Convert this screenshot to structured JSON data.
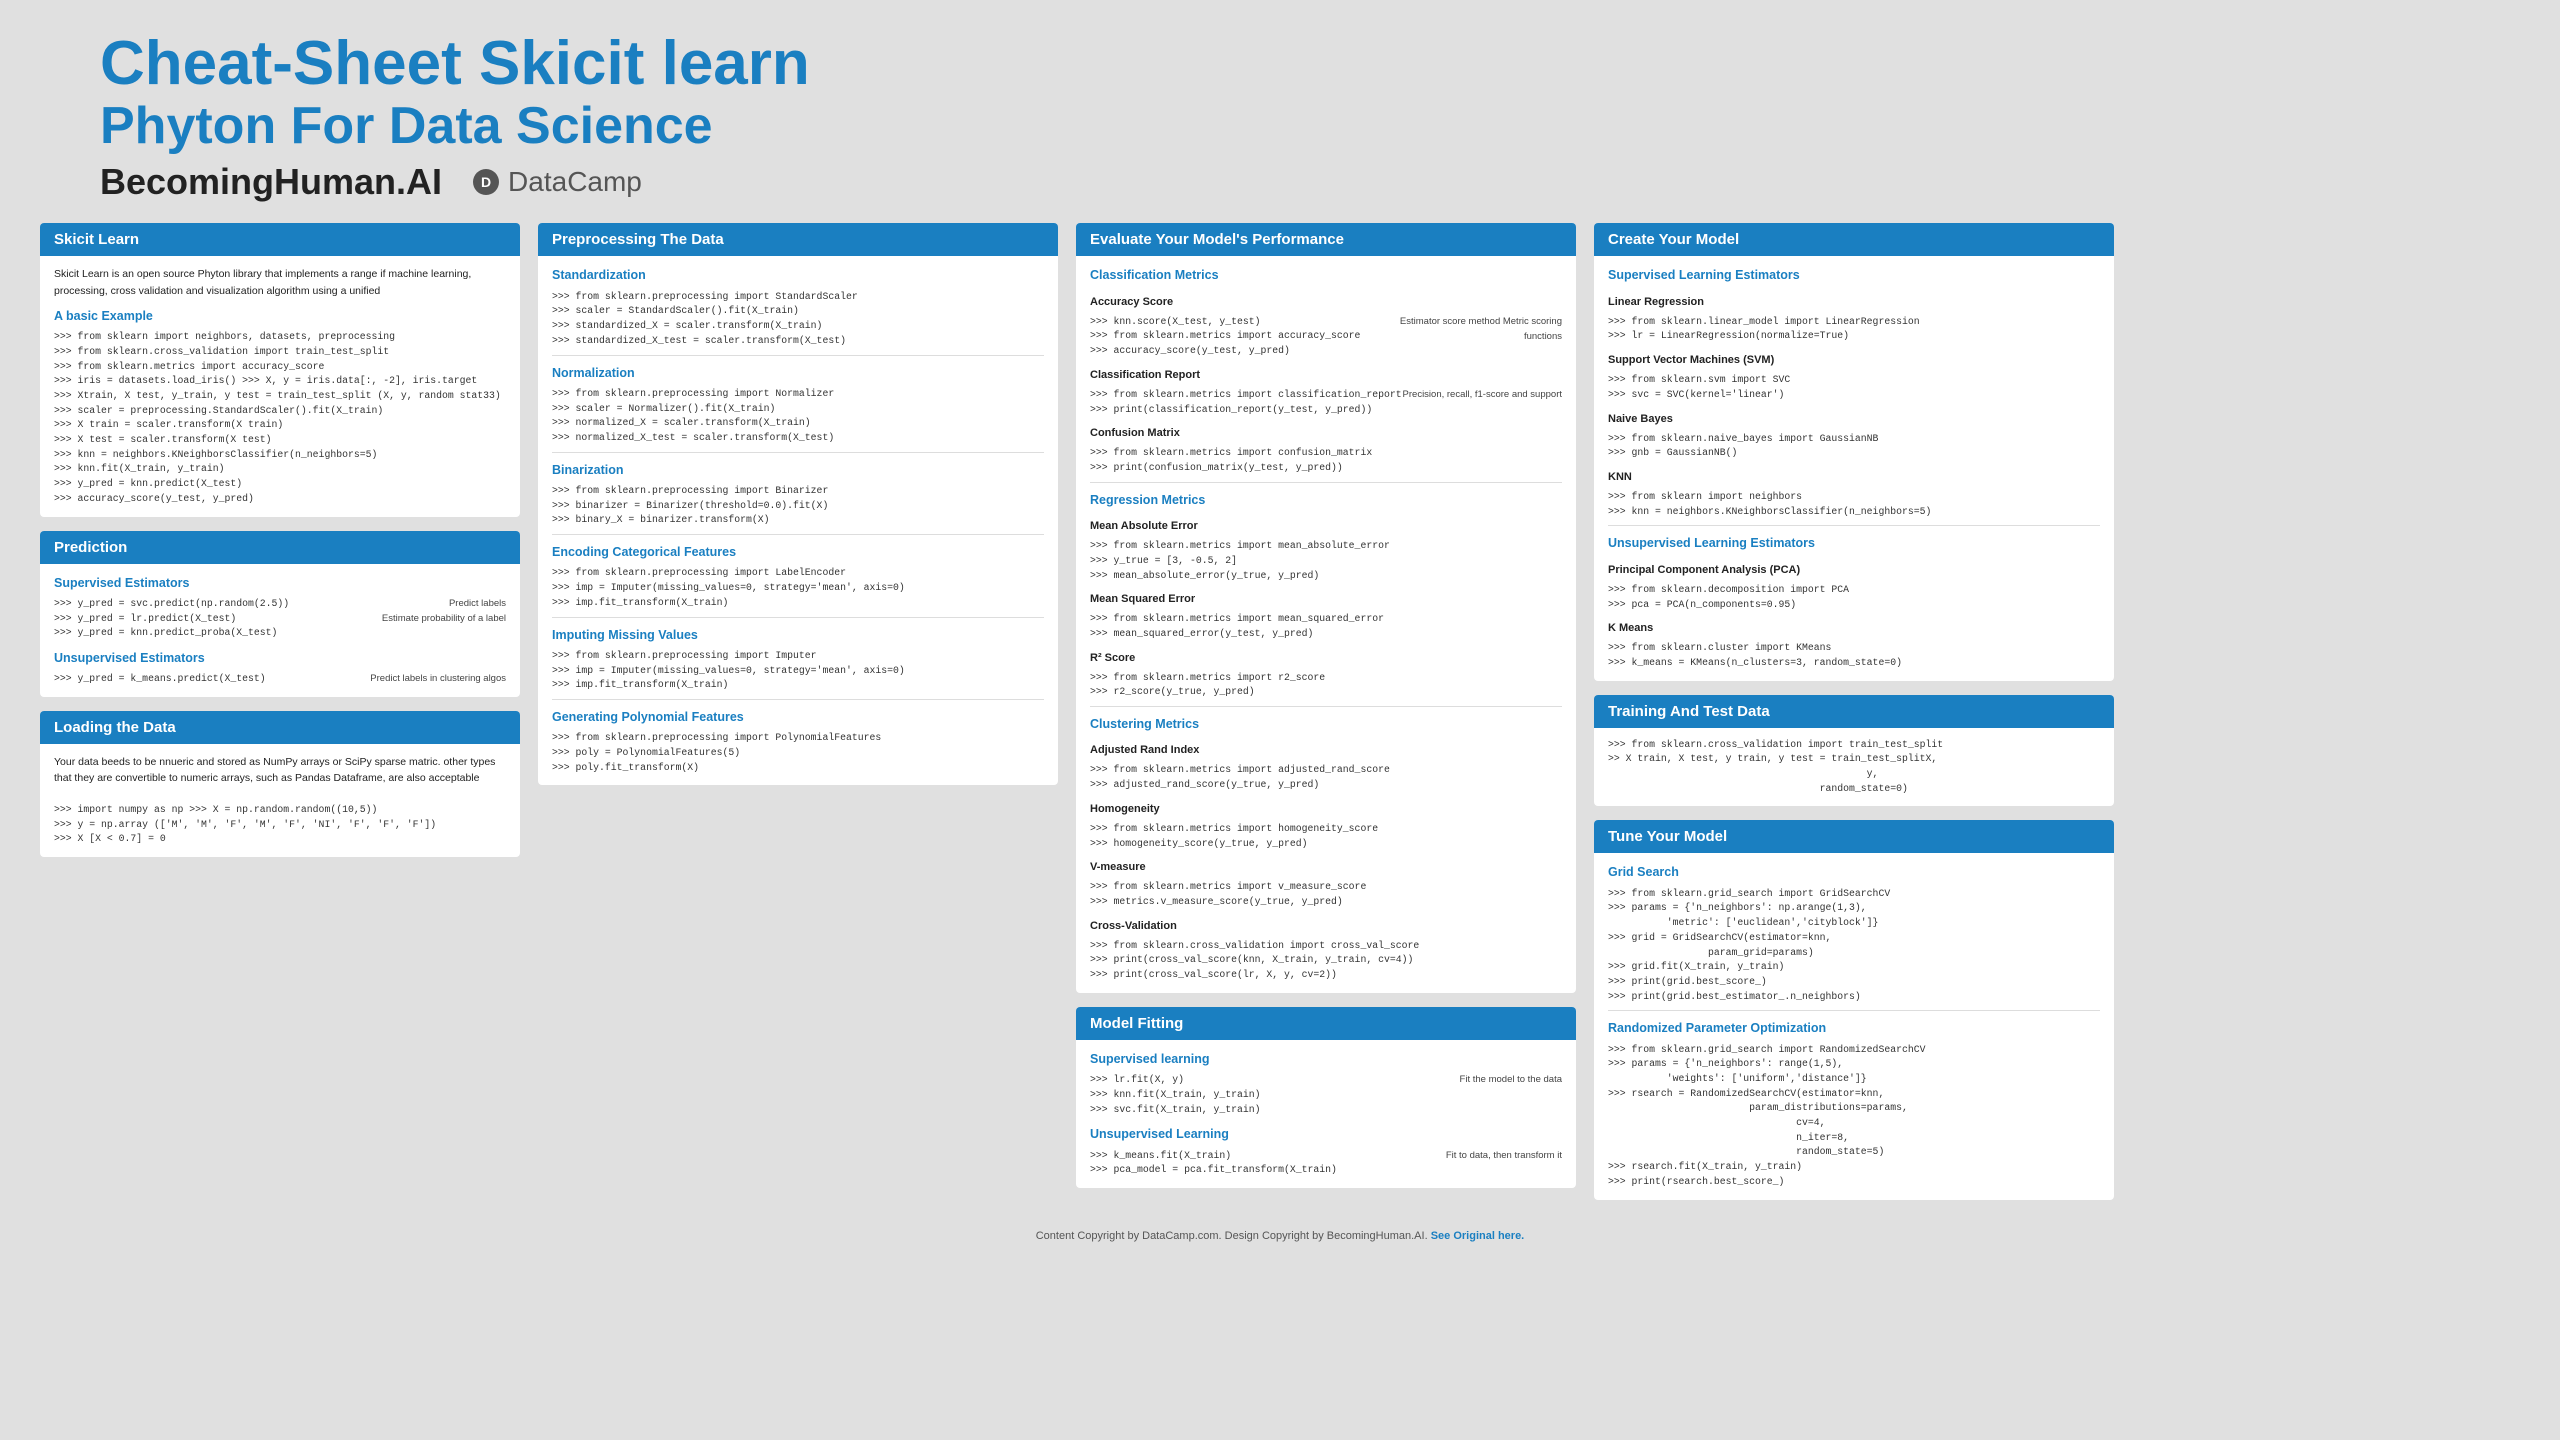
{
  "header": {
    "line1": "Cheat-Sheet  Skicit learn",
    "line2": "Phyton For Data Science",
    "brand": "BecomingHuman.AI",
    "datacamp_label": "DataCamp"
  },
  "footer": {
    "text": "Content Copyright by DataCamp.com. Design Copyright by BecomingHuman.AI.",
    "link_text": "See Original here."
  },
  "col1": {
    "skicit_learn": {
      "title": "Skicit Learn",
      "intro": "Skicit Learn is an open source Phyton library that implements a range if machine learning, processing, cross validation and visualization algorithm using a unified",
      "basic_example_title": "A basic Example",
      "basic_example_code": ">>> from sklearn import neighbors, datasets, preprocessing\n>>> from sklearn.cross_validation import train_test_split\n>>> from sklearn.metrics import accuracy_score\n>>> iris = datasets.load_iris() >>> X, y = iris.data[:, -2], iris.target\n>>> Xtrain, X test, y_train, y test = train_test_split (X, y, random stat33)\n>>> scaler = preprocessing.StandardScaler().fit(X_train)\n>>> X train = scaler.transform(X train)\n>>> X test = scaler.transform(X test)\n>>> knn = neighbors.KNeighborsClassifier(n_neighbors=5)\n>>> knn.fit(X_train, y_train)\n>>> y_pred = knn.predict(X_test)\n>>> accuracy_score(y_test, y_pred)"
    },
    "prediction": {
      "title": "Prediction",
      "supervised_title": "Supervised Estimators",
      "supervised_code": ">>> y_pred = svc.predict(np.random(2.5))\n>>> y_pred = lr.predict(X_test)\n>>> y_pred = knn.predict_proba(X_test)",
      "supervised_right1": "Predict labels",
      "supervised_right2": "Estimate probability of a label",
      "unsupervised_title": "Unsupervised Estimators",
      "unsupervised_code": ">>> y_pred = k_means.predict(X_test)",
      "unsupervised_right": "Predict labels in clustering algos"
    },
    "loading": {
      "title": "Loading the Data",
      "description": "Your data beeds to be nnueric and stored as NumPy arrays or SciPy sparse matric. other types that they are convertible to numeric arrays, such as Pandas Dataframe, are also acceptable",
      "code": ">>> import numpy as np >>> X = np.random.random((10,5))\n>>> y = np.array (['M', 'M', 'F', 'M', 'F', 'NI', 'F', 'F', 'F'])\n>>> X [X < 0.7] = 0"
    }
  },
  "col2": {
    "preprocessing": {
      "title": "Preprocessing The Data",
      "standardization_title": "Standardization",
      "standardization_code": ">>> from sklearn.preprocessing import StandardScaler\n>>> scaler = StandardScaler().fit(X_train)\n>>> standardized_X = scaler.transform(X_train)\n>>> standardized_X_test = scaler.transform(X_test)",
      "normalization_title": "Normalization",
      "normalization_code": ">>> from sklearn.preprocessing import Normalizer\n>>> scaler = Normalizer().fit(X_train)\n>>> normalized_X = scaler.transform(X_train)\n>>> normalized_X_test = scaler.transform(X_test)",
      "binarization_title": "Binarization",
      "binarization_code": ">>> from sklearn.preprocessing import Binarizer\n>>> binarizer = Binarizer(threshold=0.0).fit(X)\n>>> binary_X = binarizer.transform(X)",
      "encoding_title": "Encoding Categorical Features",
      "encoding_code": ">>> from sklearn.preprocessing import LabelEncoder\n>>> imp = Imputer(missing_values=0, strategy='mean', axis=0)\n>>> imp.fit_transform(X_train)",
      "imputing_title": "Imputing Missing Values",
      "imputing_code": ">>> from sklearn.preprocessing import Imputer\n>>> imp = Imputer(missing_values=0, strategy='mean', axis=0)\n>>> imp.fit_transform(X_train)",
      "polynomial_title": "Generating Polynomial Features",
      "polynomial_code": ">>> from sklearn.preprocessing import PolynomialFeatures\n>>> poly = PolynomialFeatures(5)\n>>> poly.fit_transform(X)"
    }
  },
  "col3": {
    "evaluate": {
      "title": "Evaluate Your Model's Performance",
      "classification_title": "Classification Metrics",
      "accuracy_title": "Accuracy Score",
      "accuracy_code": ">>> knn.score(X_test, y_test)\n>>> from sklearn.metrics import accuracy_score\n>>> accuracy_score(y_test, y_pred)",
      "accuracy_right": "Estimator score method\nMetric scoring functions",
      "classification_report_title": "Classification Report",
      "classification_report_code": ">>> from sklearn.metrics import classification_report\n>>> print(classification_report(y_test, y_pred))",
      "classification_report_right": "Precision, recall, f1-score\nand support",
      "confusion_matrix_title": "Confusion Matrix",
      "confusion_matrix_code": ">>> from sklearn.metrics import confusion_matrix\n>>> print(confusion_matrix(y_test, y_pred))",
      "regression_title": "Regression Metrics",
      "mae_title": "Mean Absolute Error",
      "mae_code": ">>> from sklearn.metrics import mean_absolute_error\n>>> y_true = [3, -0.5, 2]\n>>> mean_absolute_error(y_true, y_pred)",
      "mse_title": "Mean Squared Error",
      "mse_code": ">>> from sklearn.metrics import mean_squared_error\n>>> mean_squared_error(y_test, y_pred)",
      "r2_title": "R² Score",
      "r2_code": ">>> from sklearn.metrics import r2_score\n>>> r2_score(y_true, y_pred)",
      "clustering_title": "Clustering Metrics",
      "ari_title": "Adjusted Rand Index",
      "ari_code": ">>> from sklearn.metrics import adjusted_rand_score\n>>> adjusted_rand_score(y_true, y_pred)",
      "homogeneity_title": "Homogeneity",
      "homogeneity_code": ">>> from sklearn.metrics import homogeneity_score\n>>> homogeneity_score(y_true, y_pred)",
      "vmeasure_title": "V-measure",
      "vmeasure_code": ">>> from sklearn.metrics import v_measure_score\n>>> metrics.v_measure_score(y_true, y_pred)",
      "crossval_title": "Cross-Validation",
      "crossval_code": ">>> from sklearn.cross_validation import cross_val_score\n>>> print(cross_val_score(knn, X_train, y_train, cv=4))\n>>> print(cross_val_score(lr, X, y, cv=2))"
    },
    "model_fitting": {
      "title": "Model Fitting",
      "supervised_title": "Supervised learning",
      "supervised_code": ">>> lr.fit(X, y)\n>>> knn.fit(X_train, y_train)\n>>> svc.fit(X_train, y_train)",
      "supervised_right": "Fit the model to the data",
      "unsupervised_title": "Unsupervised Learning",
      "unsupervised_code": ">>> k_means.fit(X_train)\n>>> pca_model = pca.fit_transform(X_train)",
      "unsupervised_right": "Fit to data, then transform it"
    }
  },
  "col4": {
    "create_model": {
      "title": "Create Your Model",
      "supervised_title": "Supervised Learning Estimators",
      "linear_regression_title": "Linear Regression",
      "linear_regression_code": ">>> from sklearn.linear_model import LinearRegression\n>>> lr = LinearRegression(normalize=True)",
      "svm_title": "Support Vector Machines (SVM)",
      "svm_code": ">>> from sklearn.svm import SVC\n>>> svc = SVC(kernel='linear')",
      "naive_bayes_title": "Naive Bayes",
      "naive_bayes_code": ">>> from sklearn.naive_bayes import GaussianNB\n>>> gnb = GaussianNB()",
      "knn_title": "KNN",
      "knn_code": ">>> from sklearn import neighbors\n>>> knn = neighbors.KNeighborsClassifier(n_neighbors=5)",
      "unsupervised_title": "Unsupervised Learning Estimators",
      "pca_title": "Principal Component Analysis (PCA)",
      "pca_code": ">>> from sklearn.decomposition import PCA\n>>> pca = PCA(n_components=0.95)",
      "kmeans_title": "K Means",
      "kmeans_code": ">>> from sklearn.cluster import KMeans\n>>> k_means = KMeans(n_clusters=3, random_state=0)"
    },
    "training": {
      "title": "Training And Test Data",
      "code": ">>> from sklearn.cross_validation import train_test_split\n>> X train, X test, y train, y test = train_test_splitX,\n                                            y,\n                                    random_state=0)"
    },
    "tune": {
      "title": "Tune Your Model",
      "grid_search_title": "Grid Search",
      "grid_search_code": ">>> from sklearn.grid_search import GridSearchCV\n>>> params = {'n_neighbors': np.arange(1,3),\n          'metric': ['euclidean','cityblock']}\n>>> grid = GridSearchCV(estimator=knn,\n                 param_grid=params)\n>>> grid.fit(X_train, y_train)\n>>> print(grid.best_score_)\n>>> print(grid.best_estimator_.n_neighbors)",
      "random_title": "Randomized Parameter Optimization",
      "random_code": ">>> from sklearn.grid_search import RandomizedSearchCV\n>>> params = {'n_neighbors': range(1,5),\n          'weights': ['uniform','distance']}\n>>> rsearch = RandomizedSearchCV(estimator=knn,\n                        param_distributions=params,\n                                cv=4,\n                                n_iter=8,\n                                random_state=5)\n>>> rsearch.fit(X_train, y_train)\n>>> print(rsearch.best_score_)"
    }
  }
}
